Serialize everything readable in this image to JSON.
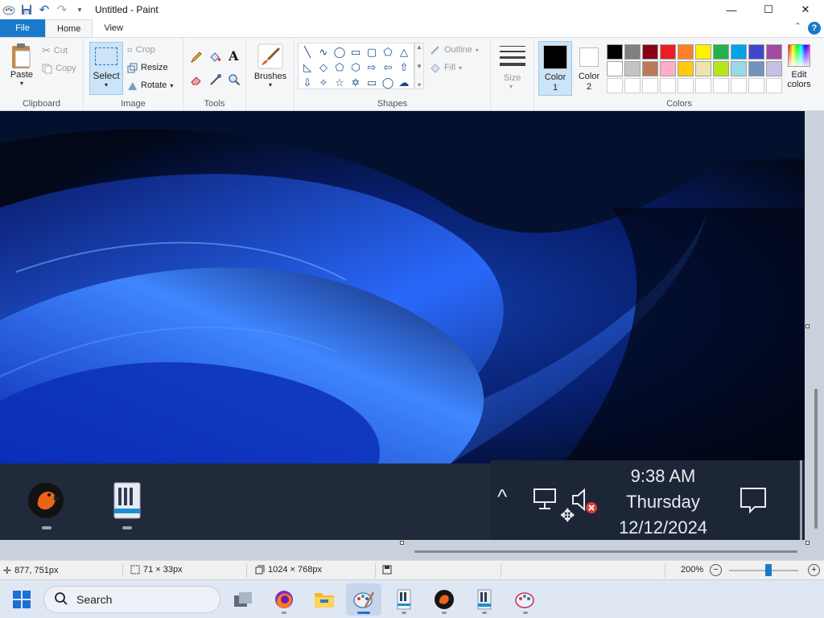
{
  "window": {
    "title": "Untitled - Paint",
    "controls": {
      "minimize": "—",
      "maximize": "☐",
      "close": "✕"
    }
  },
  "tabs": [
    {
      "label": "File"
    },
    {
      "label": "Home"
    },
    {
      "label": "View"
    }
  ],
  "ribbon": {
    "clipboard": {
      "label": "Clipboard",
      "paste": "Paste",
      "cut": "Cut",
      "copy": "Copy"
    },
    "image": {
      "label": "Image",
      "select": "Select",
      "crop": "Crop",
      "resize": "Resize",
      "rotate": "Rotate"
    },
    "tools": {
      "label": "Tools"
    },
    "brushes": {
      "label": "Brushes"
    },
    "shapes": {
      "label": "Shapes",
      "outline": "Outline",
      "fill": "Fill"
    },
    "size": {
      "label": "Size"
    },
    "colors": {
      "label": "Colors",
      "color1_line1": "Color",
      "color1_line2": "1",
      "color2_line1": "Color",
      "color2_line2": "2",
      "edit_line1": "Edit",
      "edit_line2": "colors",
      "color1_value": "#000000",
      "color2_value": "#ffffff",
      "palette_row1": [
        "#000000",
        "#7f7f7f",
        "#880015",
        "#ed1c24",
        "#ff7f27",
        "#fff200",
        "#22b14c",
        "#00a2e8",
        "#3f48cc",
        "#a349a4"
      ],
      "palette_row2": [
        "#ffffff",
        "#c3c3c3",
        "#b97a57",
        "#ffaec9",
        "#ffc90e",
        "#efe4b0",
        "#b5e61d",
        "#99d9ea",
        "#7092be",
        "#c8bfe7"
      ]
    }
  },
  "canvas_content": {
    "clock_time": "9:38 AM",
    "clock_day": "Thursday",
    "clock_date": "12/12/2024"
  },
  "status": {
    "cursor_pos": "877, 751px",
    "selection_size": "71 × 33px",
    "image_size": "1024 × 768px",
    "zoom": "200%",
    "zoom_minus": "−",
    "zoom_plus": "+"
  },
  "taskbar": {
    "search_placeholder": "Search"
  }
}
